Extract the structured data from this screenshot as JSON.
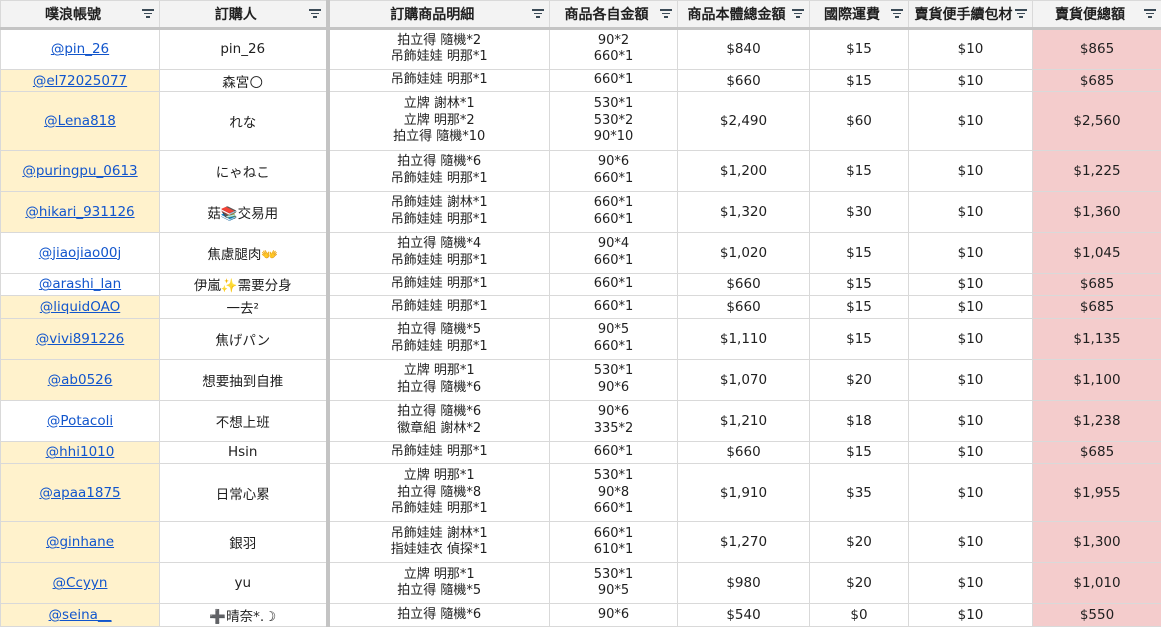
{
  "columns": {
    "account": "噗浪帳號",
    "buyer": "訂購人",
    "items": "訂購商品明細",
    "unit_prices": "商品各自金額",
    "subtotal": "商品本體總金額",
    "shipping": "國際運費",
    "fee": "賣貨便手續包材",
    "total": "賣貨便總額"
  },
  "colors": {
    "link": "#1155cc",
    "highlight": "#fff2cc",
    "total_bg": "#f4cccc",
    "header_bg": "#f3f3f3"
  },
  "rows": [
    {
      "account": "@pin_26",
      "buyer": "pin_26",
      "items": [
        "拍立得 隨機*2",
        "吊飾娃娃 明那*1"
      ],
      "prices": [
        "90*2",
        "660*1"
      ],
      "subtotal": "$840",
      "shipping": "$15",
      "fee": "$10",
      "total": "$865",
      "highlight": false
    },
    {
      "account": "@el72025077",
      "buyer": "森宮🌕",
      "items": [
        "吊飾娃娃 明那*1"
      ],
      "prices": [
        "660*1"
      ],
      "subtotal": "$660",
      "shipping": "$15",
      "fee": "$10",
      "total": "$685",
      "highlight": true
    },
    {
      "account": "@Lena818",
      "buyer": "れな",
      "items": [
        "立牌 謝林*1",
        "立牌 明那*2",
        "拍立得 隨機*10"
      ],
      "prices": [
        "530*1",
        "530*2",
        "90*10"
      ],
      "subtotal": "$2,490",
      "shipping": "$60",
      "fee": "$10",
      "total": "$2,560",
      "highlight": true
    },
    {
      "account": "@puringpu_0613",
      "buyer": "にゃねこ",
      "items": [
        "拍立得 隨機*6",
        "吊飾娃娃 明那*1"
      ],
      "prices": [
        "90*6",
        "660*1"
      ],
      "subtotal": "$1,200",
      "shipping": "$15",
      "fee": "$10",
      "total": "$1,225",
      "highlight": true
    },
    {
      "account": "@hikari_931126",
      "buyer": "菇📚交易用",
      "items": [
        "吊飾娃娃 謝林*1",
        "吊飾娃娃 明那*1"
      ],
      "prices": [
        "660*1",
        "660*1"
      ],
      "subtotal": "$1,320",
      "shipping": "$30",
      "fee": "$10",
      "total": "$1,360",
      "highlight": true
    },
    {
      "account": "@jiaojiao00j",
      "buyer": "焦慮腿肉👐",
      "items": [
        "拍立得 隨機*4",
        "吊飾娃娃 明那*1"
      ],
      "prices": [
        "90*4",
        "660*1"
      ],
      "subtotal": "$1,020",
      "shipping": "$15",
      "fee": "$10",
      "total": "$1,045",
      "highlight": false
    },
    {
      "account": "@arashi_lan",
      "buyer": "伊嵐✨需要分身",
      "items": [
        "吊飾娃娃 明那*1"
      ],
      "prices": [
        "660*1"
      ],
      "subtotal": "$660",
      "shipping": "$15",
      "fee": "$10",
      "total": "$685",
      "highlight": false
    },
    {
      "account": "@liquidOAO",
      "buyer": "一去²",
      "items": [
        "吊飾娃娃 明那*1"
      ],
      "prices": [
        "660*1"
      ],
      "subtotal": "$660",
      "shipping": "$15",
      "fee": "$10",
      "total": "$685",
      "highlight": true
    },
    {
      "account": "@vivi891226",
      "buyer": "焦げパン",
      "items": [
        "拍立得 隨機*5",
        "吊飾娃娃 明那*1"
      ],
      "prices": [
        "90*5",
        "660*1"
      ],
      "subtotal": "$1,110",
      "shipping": "$15",
      "fee": "$10",
      "total": "$1,135",
      "highlight": true
    },
    {
      "account": "@ab0526",
      "buyer": "想要抽到自推",
      "items": [
        "立牌 明那*1",
        "拍立得 隨機*6"
      ],
      "prices": [
        "530*1",
        "90*6"
      ],
      "subtotal": "$1,070",
      "shipping": "$20",
      "fee": "$10",
      "total": "$1,100",
      "highlight": true
    },
    {
      "account": "@Potacoli",
      "buyer": "不想上班",
      "items": [
        "拍立得 隨機*6",
        "徽章組 謝林*2"
      ],
      "prices": [
        "90*6",
        "335*2"
      ],
      "subtotal": "$1,210",
      "shipping": "$18",
      "fee": "$10",
      "total": "$1,238",
      "highlight": false
    },
    {
      "account": "@hhi1010",
      "buyer": "Hsin",
      "items": [
        "吊飾娃娃 明那*1"
      ],
      "prices": [
        "660*1"
      ],
      "subtotal": "$660",
      "shipping": "$15",
      "fee": "$10",
      "total": "$685",
      "highlight": true
    },
    {
      "account": "@apaa1875",
      "buyer": "日常心累",
      "items": [
        "立牌 明那*1",
        "拍立得 隨機*8",
        "吊飾娃娃 明那*1"
      ],
      "prices": [
        "530*1",
        "90*8",
        "660*1"
      ],
      "subtotal": "$1,910",
      "shipping": "$35",
      "fee": "$10",
      "total": "$1,955",
      "highlight": true
    },
    {
      "account": "@ginhane",
      "buyer": "銀羽",
      "items": [
        "吊飾娃娃 謝林*1",
        "指娃娃衣 偵探*1"
      ],
      "prices": [
        "660*1",
        "610*1"
      ],
      "subtotal": "$1,270",
      "shipping": "$20",
      "fee": "$10",
      "total": "$1,300",
      "highlight": true
    },
    {
      "account": "@Ccyyn",
      "buyer": "yu",
      "items": [
        "立牌 明那*1",
        "拍立得 隨機*5"
      ],
      "prices": [
        "530*1",
        "90*5"
      ],
      "subtotal": "$980",
      "shipping": "$20",
      "fee": "$10",
      "total": "$1,010",
      "highlight": true
    },
    {
      "account": "@seina__",
      "buyer": "➕晴奈*.☽",
      "items": [
        "拍立得 隨機*6"
      ],
      "prices": [
        "90*6"
      ],
      "subtotal": "$540",
      "shipping": "$0",
      "fee": "$10",
      "total": "$550",
      "highlight": true
    }
  ]
}
